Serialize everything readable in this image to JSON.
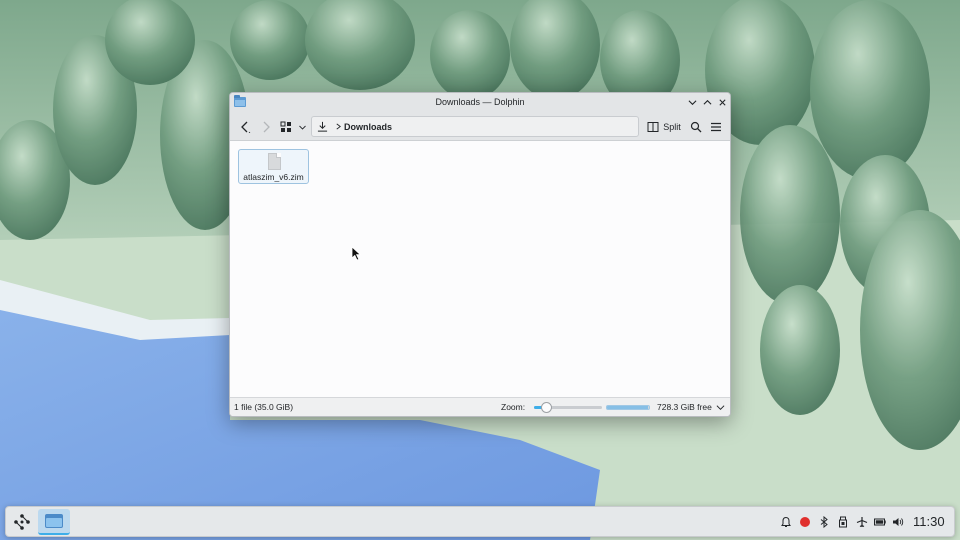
{
  "window": {
    "title": "Downloads — Dolphin"
  },
  "toolbar": {
    "split_label": "Split",
    "breadcrumb": "Downloads"
  },
  "files": [
    {
      "name": "atlaszim_v6.zim",
      "type": "file"
    }
  ],
  "statusbar": {
    "summary": "1 file (35.0 GiB)",
    "zoom_label": "Zoom:",
    "zoom_level": 0.12,
    "free_space_text": "728.3 GiB free",
    "used_fraction": 0.97
  },
  "taskbar": {
    "clock": "11:30",
    "tray_icons": [
      "notifications-icon",
      "record-indicator-icon",
      "bluetooth-icon",
      "usb-device-icon",
      "airplane-mode-icon",
      "battery-icon",
      "volume-icon"
    ],
    "accent": "#3daee9"
  },
  "colors": {
    "selection": "#3daee9",
    "record": "#e0302e"
  }
}
